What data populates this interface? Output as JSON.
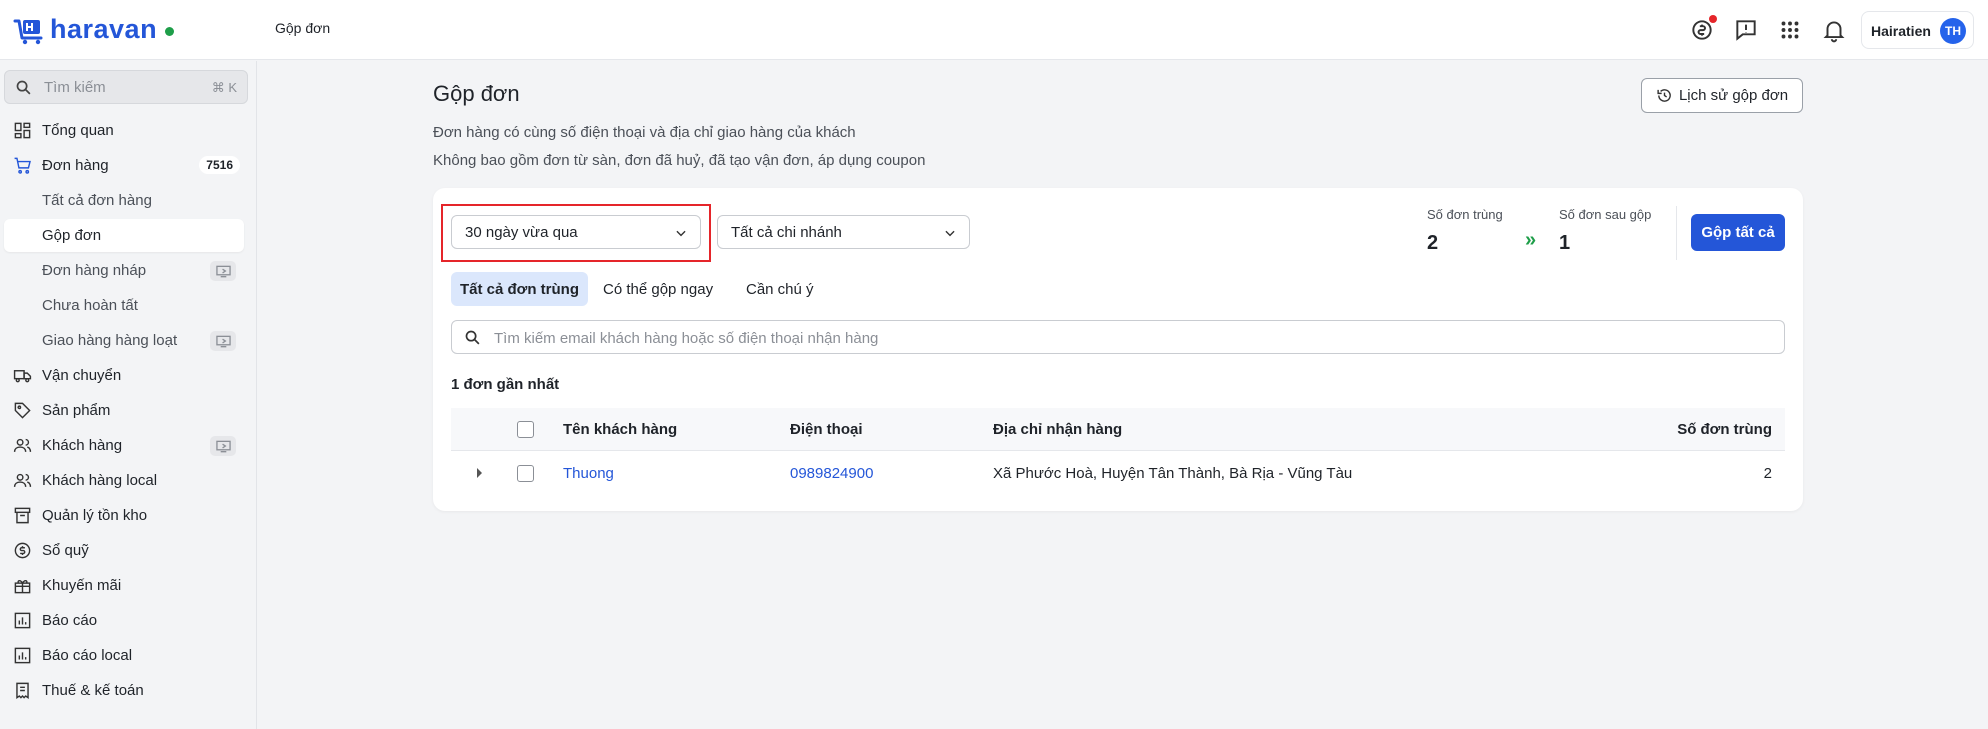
{
  "app": {
    "logo_text": "haravan"
  },
  "breadcrumb": "Gộp đơn",
  "user": {
    "name": "Hairatien",
    "initials": "TH"
  },
  "sidebar": {
    "search_placeholder": "Tìm kiếm",
    "search_shortcut": "⌘ K",
    "items": [
      {
        "label": "Tổng quan",
        "icon": "dashboard-icon"
      },
      {
        "label": "Đơn hàng",
        "icon": "cart-icon",
        "badge": "7516"
      },
      {
        "label": "Tất cả đơn hàng"
      },
      {
        "label": "Gộp đơn"
      },
      {
        "label": "Đơn hàng nháp"
      },
      {
        "label": "Chưa hoàn tất"
      },
      {
        "label": "Giao hàng hàng loạt"
      },
      {
        "label": "Vận chuyển",
        "icon": "truck-icon"
      },
      {
        "label": "Sản phẩm",
        "icon": "tag-icon"
      },
      {
        "label": "Khách hàng",
        "icon": "users-icon"
      },
      {
        "label": "Khách hàng local",
        "icon": "users-icon"
      },
      {
        "label": "Quản lý tồn kho",
        "icon": "archive-icon"
      },
      {
        "label": "Sổ quỹ",
        "icon": "dollar-icon"
      },
      {
        "label": "Khuyến mãi",
        "icon": "gift-icon"
      },
      {
        "label": "Báo cáo",
        "icon": "chart-icon"
      },
      {
        "label": "Báo cáo local",
        "icon": "chart-icon"
      },
      {
        "label": "Thuế & kế toán",
        "icon": "receipt-icon"
      }
    ]
  },
  "page": {
    "title": "Gộp đơn",
    "history_button": "Lịch sử gộp đơn",
    "description_line1": "Đơn hàng có cùng số điện thoại và địa chỉ giao hàng của khách",
    "description_line2": "Không bao gồm đơn từ sàn, đơn đã huỷ, đã tạo vận đơn, áp dụng coupon"
  },
  "filters": {
    "date_range": "30 ngày vừa qua",
    "branch": "Tất cả chi nhánh"
  },
  "stats": {
    "duplicate_label": "Số đơn trùng",
    "duplicate_value": "2",
    "arrow": "»",
    "after_merge_label": "Số đơn sau gộp",
    "after_merge_value": "1",
    "merge_all_button": "Gộp tất cả"
  },
  "tabs": [
    "Tất cả đơn trùng",
    "Có thể gộp ngay",
    "Cần chú ý"
  ],
  "table_search_placeholder": "Tìm kiếm email khách hàng hoặc số điện thoại nhận hàng",
  "count_label": "1 đơn gần nhất",
  "table": {
    "columns": [
      "Tên khách hàng",
      "Điện thoại",
      "Địa chỉ nhận hàng",
      "Số đơn trùng"
    ],
    "rows": [
      {
        "customer": "Thuong",
        "phone": "0989824900",
        "address": "Xã Phước Hoà, Huyện Tân Thành, Bà Rịa - Vũng Tàu",
        "dup_count": "2"
      }
    ]
  }
}
